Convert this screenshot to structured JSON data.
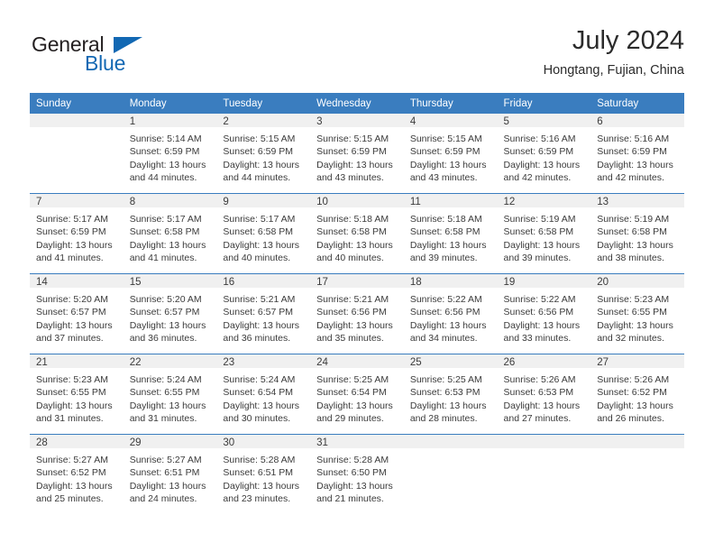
{
  "brand": {
    "name_part1": "General",
    "name_part2": "Blue",
    "accent_color": "#1268b3"
  },
  "header": {
    "title": "July 2024",
    "subtitle": "Hongtang, Fujian, China"
  },
  "theme": {
    "header_row_bg": "#3a7dbf",
    "daynum_band_bg": "#f0f0f0",
    "text_color": "#3b3b3b"
  },
  "calendar": {
    "weekday_headers": [
      "Sunday",
      "Monday",
      "Tuesday",
      "Wednesday",
      "Thursday",
      "Friday",
      "Saturday"
    ],
    "weeks": [
      [
        {
          "day": "",
          "sunrise": "",
          "sunset": "",
          "daylight_line1": "",
          "daylight_line2": ""
        },
        {
          "day": "1",
          "sunrise": "Sunrise: 5:14 AM",
          "sunset": "Sunset: 6:59 PM",
          "daylight_line1": "Daylight: 13 hours",
          "daylight_line2": "and 44 minutes."
        },
        {
          "day": "2",
          "sunrise": "Sunrise: 5:15 AM",
          "sunset": "Sunset: 6:59 PM",
          "daylight_line1": "Daylight: 13 hours",
          "daylight_line2": "and 44 minutes."
        },
        {
          "day": "3",
          "sunrise": "Sunrise: 5:15 AM",
          "sunset": "Sunset: 6:59 PM",
          "daylight_line1": "Daylight: 13 hours",
          "daylight_line2": "and 43 minutes."
        },
        {
          "day": "4",
          "sunrise": "Sunrise: 5:15 AM",
          "sunset": "Sunset: 6:59 PM",
          "daylight_line1": "Daylight: 13 hours",
          "daylight_line2": "and 43 minutes."
        },
        {
          "day": "5",
          "sunrise": "Sunrise: 5:16 AM",
          "sunset": "Sunset: 6:59 PM",
          "daylight_line1": "Daylight: 13 hours",
          "daylight_line2": "and 42 minutes."
        },
        {
          "day": "6",
          "sunrise": "Sunrise: 5:16 AM",
          "sunset": "Sunset: 6:59 PM",
          "daylight_line1": "Daylight: 13 hours",
          "daylight_line2": "and 42 minutes."
        }
      ],
      [
        {
          "day": "7",
          "sunrise": "Sunrise: 5:17 AM",
          "sunset": "Sunset: 6:59 PM",
          "daylight_line1": "Daylight: 13 hours",
          "daylight_line2": "and 41 minutes."
        },
        {
          "day": "8",
          "sunrise": "Sunrise: 5:17 AM",
          "sunset": "Sunset: 6:58 PM",
          "daylight_line1": "Daylight: 13 hours",
          "daylight_line2": "and 41 minutes."
        },
        {
          "day": "9",
          "sunrise": "Sunrise: 5:17 AM",
          "sunset": "Sunset: 6:58 PM",
          "daylight_line1": "Daylight: 13 hours",
          "daylight_line2": "and 40 minutes."
        },
        {
          "day": "10",
          "sunrise": "Sunrise: 5:18 AM",
          "sunset": "Sunset: 6:58 PM",
          "daylight_line1": "Daylight: 13 hours",
          "daylight_line2": "and 40 minutes."
        },
        {
          "day": "11",
          "sunrise": "Sunrise: 5:18 AM",
          "sunset": "Sunset: 6:58 PM",
          "daylight_line1": "Daylight: 13 hours",
          "daylight_line2": "and 39 minutes."
        },
        {
          "day": "12",
          "sunrise": "Sunrise: 5:19 AM",
          "sunset": "Sunset: 6:58 PM",
          "daylight_line1": "Daylight: 13 hours",
          "daylight_line2": "and 39 minutes."
        },
        {
          "day": "13",
          "sunrise": "Sunrise: 5:19 AM",
          "sunset": "Sunset: 6:58 PM",
          "daylight_line1": "Daylight: 13 hours",
          "daylight_line2": "and 38 minutes."
        }
      ],
      [
        {
          "day": "14",
          "sunrise": "Sunrise: 5:20 AM",
          "sunset": "Sunset: 6:57 PM",
          "daylight_line1": "Daylight: 13 hours",
          "daylight_line2": "and 37 minutes."
        },
        {
          "day": "15",
          "sunrise": "Sunrise: 5:20 AM",
          "sunset": "Sunset: 6:57 PM",
          "daylight_line1": "Daylight: 13 hours",
          "daylight_line2": "and 36 minutes."
        },
        {
          "day": "16",
          "sunrise": "Sunrise: 5:21 AM",
          "sunset": "Sunset: 6:57 PM",
          "daylight_line1": "Daylight: 13 hours",
          "daylight_line2": "and 36 minutes."
        },
        {
          "day": "17",
          "sunrise": "Sunrise: 5:21 AM",
          "sunset": "Sunset: 6:56 PM",
          "daylight_line1": "Daylight: 13 hours",
          "daylight_line2": "and 35 minutes."
        },
        {
          "day": "18",
          "sunrise": "Sunrise: 5:22 AM",
          "sunset": "Sunset: 6:56 PM",
          "daylight_line1": "Daylight: 13 hours",
          "daylight_line2": "and 34 minutes."
        },
        {
          "day": "19",
          "sunrise": "Sunrise: 5:22 AM",
          "sunset": "Sunset: 6:56 PM",
          "daylight_line1": "Daylight: 13 hours",
          "daylight_line2": "and 33 minutes."
        },
        {
          "day": "20",
          "sunrise": "Sunrise: 5:23 AM",
          "sunset": "Sunset: 6:55 PM",
          "daylight_line1": "Daylight: 13 hours",
          "daylight_line2": "and 32 minutes."
        }
      ],
      [
        {
          "day": "21",
          "sunrise": "Sunrise: 5:23 AM",
          "sunset": "Sunset: 6:55 PM",
          "daylight_line1": "Daylight: 13 hours",
          "daylight_line2": "and 31 minutes."
        },
        {
          "day": "22",
          "sunrise": "Sunrise: 5:24 AM",
          "sunset": "Sunset: 6:55 PM",
          "daylight_line1": "Daylight: 13 hours",
          "daylight_line2": "and 31 minutes."
        },
        {
          "day": "23",
          "sunrise": "Sunrise: 5:24 AM",
          "sunset": "Sunset: 6:54 PM",
          "daylight_line1": "Daylight: 13 hours",
          "daylight_line2": "and 30 minutes."
        },
        {
          "day": "24",
          "sunrise": "Sunrise: 5:25 AM",
          "sunset": "Sunset: 6:54 PM",
          "daylight_line1": "Daylight: 13 hours",
          "daylight_line2": "and 29 minutes."
        },
        {
          "day": "25",
          "sunrise": "Sunrise: 5:25 AM",
          "sunset": "Sunset: 6:53 PM",
          "daylight_line1": "Daylight: 13 hours",
          "daylight_line2": "and 28 minutes."
        },
        {
          "day": "26",
          "sunrise": "Sunrise: 5:26 AM",
          "sunset": "Sunset: 6:53 PM",
          "daylight_line1": "Daylight: 13 hours",
          "daylight_line2": "and 27 minutes."
        },
        {
          "day": "27",
          "sunrise": "Sunrise: 5:26 AM",
          "sunset": "Sunset: 6:52 PM",
          "daylight_line1": "Daylight: 13 hours",
          "daylight_line2": "and 26 minutes."
        }
      ],
      [
        {
          "day": "28",
          "sunrise": "Sunrise: 5:27 AM",
          "sunset": "Sunset: 6:52 PM",
          "daylight_line1": "Daylight: 13 hours",
          "daylight_line2": "and 25 minutes."
        },
        {
          "day": "29",
          "sunrise": "Sunrise: 5:27 AM",
          "sunset": "Sunset: 6:51 PM",
          "daylight_line1": "Daylight: 13 hours",
          "daylight_line2": "and 24 minutes."
        },
        {
          "day": "30",
          "sunrise": "Sunrise: 5:28 AM",
          "sunset": "Sunset: 6:51 PM",
          "daylight_line1": "Daylight: 13 hours",
          "daylight_line2": "and 23 minutes."
        },
        {
          "day": "31",
          "sunrise": "Sunrise: 5:28 AM",
          "sunset": "Sunset: 6:50 PM",
          "daylight_line1": "Daylight: 13 hours",
          "daylight_line2": "and 21 minutes."
        },
        {
          "day": "",
          "sunrise": "",
          "sunset": "",
          "daylight_line1": "",
          "daylight_line2": ""
        },
        {
          "day": "",
          "sunrise": "",
          "sunset": "",
          "daylight_line1": "",
          "daylight_line2": ""
        },
        {
          "day": "",
          "sunrise": "",
          "sunset": "",
          "daylight_line1": "",
          "daylight_line2": ""
        }
      ]
    ]
  }
}
